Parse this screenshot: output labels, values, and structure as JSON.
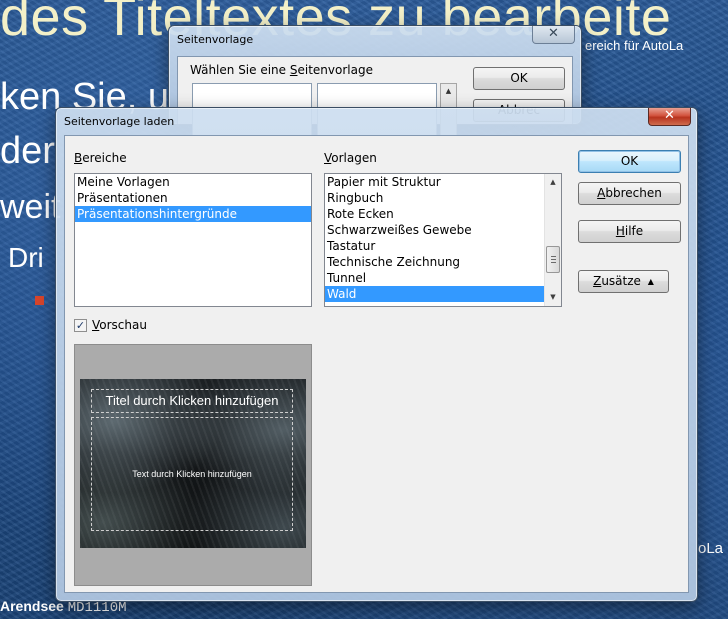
{
  "background": {
    "title_fragment": "des Titeltextes zu bearbeite",
    "line1": "ken Sie, u",
    "line2": "der",
    "line3": "weit",
    "line4": "Dri",
    "right_top_text": "ereich für AutoLa",
    "right_bottom_text": "oLa",
    "footer_name": "Arendsee",
    "footer_code": "MD1110M"
  },
  "back_dialog": {
    "title": "Seitenvorlage",
    "label": "Wählen Sie eine Seitenvorlage",
    "ok_label": "OK",
    "cancel_label_partial": "Abbrec"
  },
  "dialog": {
    "title": "Seitenvorlage laden",
    "close_glyph": "✕",
    "bereiche_label": "Bereiche",
    "bereiche": [
      {
        "label": "Meine Vorlagen",
        "selected": false
      },
      {
        "label": "Präsentationen",
        "selected": false
      },
      {
        "label": "Präsentationshintergründe",
        "selected": true
      }
    ],
    "vorlagen_label": "Vorlagen",
    "vorlagen": [
      {
        "label": "Papier mit Struktur",
        "selected": false
      },
      {
        "label": "Ringbuch",
        "selected": false
      },
      {
        "label": "Rote Ecken",
        "selected": false
      },
      {
        "label": "Schwarzweißes Gewebe",
        "selected": false
      },
      {
        "label": "Tastatur",
        "selected": false
      },
      {
        "label": "Technische Zeichnung",
        "selected": false
      },
      {
        "label": "Tunnel",
        "selected": false
      },
      {
        "label": "Wald",
        "selected": true
      }
    ],
    "vorschau_label": "Vorschau",
    "vorschau_checked": true,
    "buttons": {
      "ok": "OK",
      "abbrechen": "Abbrechen",
      "hilfe": "Hilfe",
      "zusaetze": "Zusätze"
    },
    "preview": {
      "title_text": "Titel durch Klicken hinzufügen",
      "body_text": "Text durch Klicken hinzufügen"
    }
  },
  "colors": {
    "selection": "#3399ff",
    "slide_title": "#f3f0c8",
    "close_button": "#c94a33"
  }
}
